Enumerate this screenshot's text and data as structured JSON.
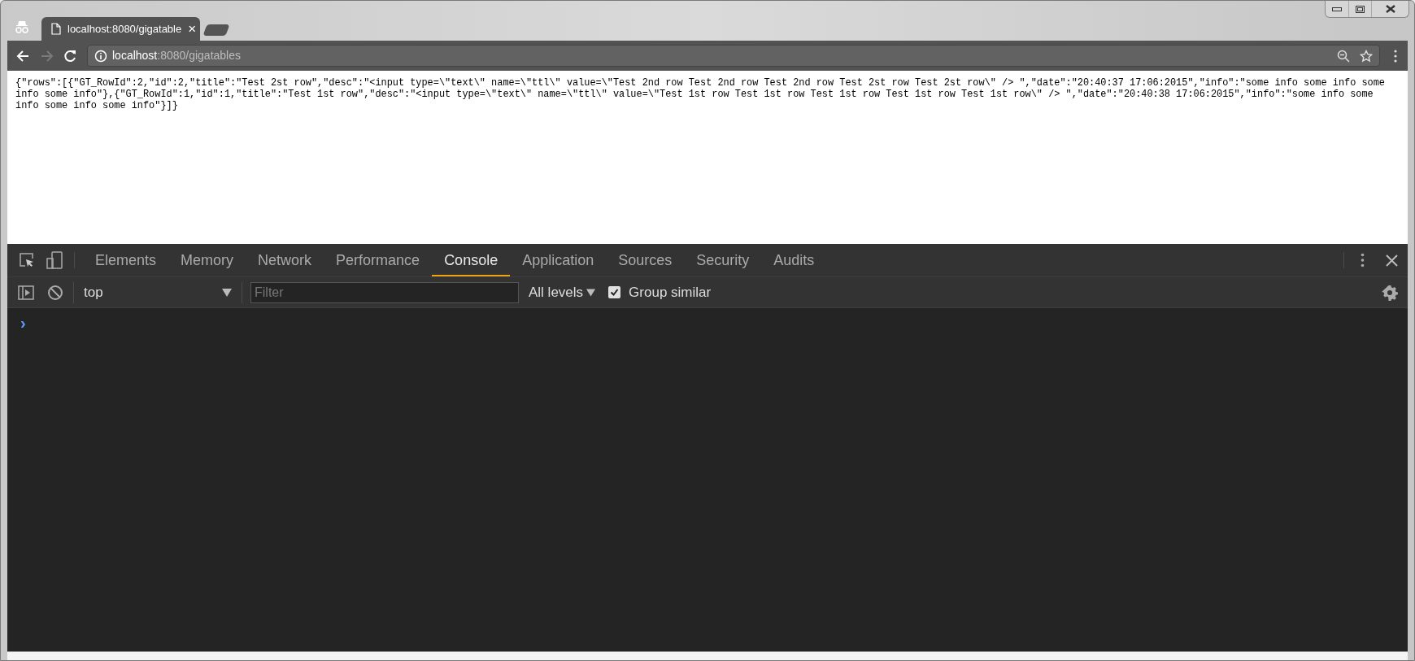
{
  "browser_tab": {
    "title": "localhost:8080/gigatable",
    "close": "×"
  },
  "address_bar": {
    "host": "localhost",
    "path": ":8080/gigatables"
  },
  "page": {
    "text": "{\"rows\":[{\"GT_RowId\":2,\"id\":2,\"title\":\"Test 2st row\",\"desc\":\"<input type=\\\"text\\\" name=\\\"ttl\\\" value=\\\"Test 2nd row Test 2nd row Test 2nd row Test 2st row Test 2st row\\\" /> \",\"date\":\"20:40:37 17:06:2015\",\"info\":\"some info some info some info some info\"},{\"GT_RowId\":1,\"id\":1,\"title\":\"Test 1st row\",\"desc\":\"<input type=\\\"text\\\" name=\\\"ttl\\\" value=\\\"Test 1st row Test 1st row Test 1st row Test 1st row Test 1st row\\\" /> \",\"date\":\"20:40:38 17:06:2015\",\"info\":\"some info some info some info some info\"}]}"
  },
  "devtools": {
    "tabs": [
      {
        "label": "Elements",
        "selected": false
      },
      {
        "label": "Memory",
        "selected": false
      },
      {
        "label": "Network",
        "selected": false
      },
      {
        "label": "Performance",
        "selected": false
      },
      {
        "label": "Console",
        "selected": true
      },
      {
        "label": "Application",
        "selected": false
      },
      {
        "label": "Sources",
        "selected": false
      },
      {
        "label": "Security",
        "selected": false
      },
      {
        "label": "Audits",
        "selected": false
      }
    ],
    "console_toolbar": {
      "context": "top",
      "filter": {
        "placeholder": "Filter"
      },
      "levels": "All levels",
      "group_similar": {
        "label": "Group similar",
        "checked": true
      }
    },
    "prompt": "›"
  }
}
